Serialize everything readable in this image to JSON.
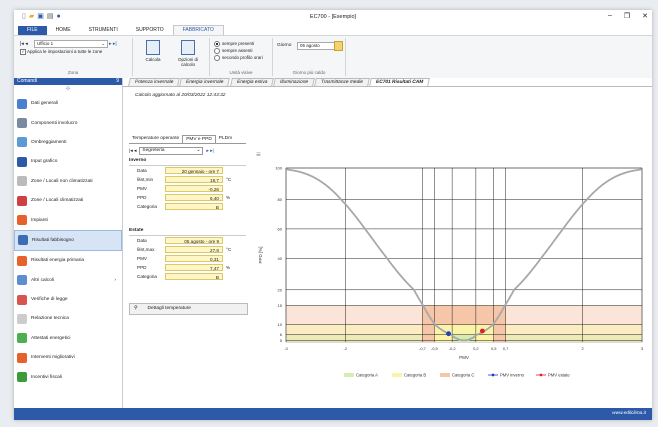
{
  "window": {
    "title": "EC700 - [Esempio]",
    "min": "–",
    "max": "❐",
    "close": "✕"
  },
  "ribbon_tabs": [
    "FILE",
    "HOME",
    "STRUMENTI",
    "SUPPORTO",
    "FABBRICATO"
  ],
  "ribbon": {
    "zona": {
      "select": "Ufficio 1",
      "checkbox_label": "Applica le impostazioni a tutte le zone",
      "caption": "Zona"
    },
    "calcolo_label": "Calcola",
    "opzioni_label": "Opzioni di calcolo",
    "radio_options": [
      "sempre presenti",
      "sempre assenti",
      "secondo profilo orari"
    ],
    "unita_caption": "Unità visive",
    "giorno_label": "Giorno",
    "giorno_value": "05 agosto",
    "giorno_caption": "Giorno più caldo"
  },
  "sidebar": {
    "header": "Comandi",
    "header_count": "9",
    "items": [
      {
        "label": "Dati generali",
        "icon": "folder-icon",
        "color": "#4a7fcf"
      },
      {
        "label": "Componenti involucro",
        "icon": "wall-icon",
        "color": "#7a8aa0"
      },
      {
        "label": "Ombreggiamenti",
        "icon": "shading-icon",
        "color": "#5b9bd5"
      },
      {
        "label": "Input grafico",
        "icon": "graphic-input-icon",
        "color": "#2c5aa8"
      },
      {
        "label": "Zone / Locali non climatizzati",
        "icon": "zone-icon",
        "color": "#bbbbbb"
      },
      {
        "label": "Zone / Locali climatizzati",
        "icon": "zone-climatized-icon",
        "color": "#d04040"
      },
      {
        "label": "Impianti",
        "icon": "flame-icon",
        "color": "#e8602c"
      },
      {
        "label": "Risultati fabbisogno",
        "icon": "results-grid-icon",
        "color": "#3b6cb5"
      },
      {
        "label": "Risultati energia primaria",
        "icon": "primary-energy-icon",
        "color": "#e8602c"
      },
      {
        "label": "Altri calcoli",
        "icon": "other-calc-icon",
        "color": "#5b8fd0",
        "arrow": "›"
      },
      {
        "label": "Verifiche di legge",
        "icon": "check-icon",
        "color": "#d9534f"
      },
      {
        "label": "Relazione tecnica",
        "icon": "report-icon",
        "color": "#cccccc"
      },
      {
        "label": "Attestati energetici",
        "icon": "certificate-icon",
        "color": "#4caf50"
      },
      {
        "label": "Interventi migliorativi",
        "icon": "house-icon",
        "color": "#e8602c"
      },
      {
        "label": "Incentivi fiscali",
        "icon": "leaf-icon",
        "color": "#3b9b3b"
      }
    ],
    "active_index": 7
  },
  "tabs": [
    "Potenza invernale",
    "Energia invernale",
    "Energia estiva",
    "Illuminazione",
    "Trasmittanze medie",
    "EC701 Risultati CAM"
  ],
  "active_tab": 5,
  "stamp": "Calcolo aggiornato al 20/03/2022 12:43:32",
  "subtabs": [
    "Temperature operante",
    "PMV e PPD",
    "PLDm"
  ],
  "active_subtab": 1,
  "nav": {
    "select": "Segreteria"
  },
  "inverno": {
    "title": "Inverno",
    "rows": [
      {
        "label": "Data",
        "value": "20 gennaio - ore 7",
        "unit": ""
      },
      {
        "label": "θint,min",
        "value": "18,7",
        "unit": "°C"
      },
      {
        "label": "PMV",
        "value": "-0,26",
        "unit": ""
      },
      {
        "label": "PPD",
        "value": "6,40",
        "unit": "%"
      },
      {
        "label": "Categoria",
        "value": "B",
        "unit": ""
      }
    ]
  },
  "estate": {
    "title": "Estate",
    "rows": [
      {
        "label": "Data",
        "value": "05 agosto - ore 9",
        "unit": ""
      },
      {
        "label": "θint,max",
        "value": "27,8",
        "unit": "°C"
      },
      {
        "label": "PMV",
        "value": "0,31",
        "unit": ""
      },
      {
        "label": "PPD",
        "value": "7,47",
        "unit": "%"
      },
      {
        "label": "Categoria",
        "value": "B",
        "unit": ""
      }
    ]
  },
  "details_button": "Dettagli temperature",
  "statusbar": "www.edilclima.it",
  "chart_data": {
    "type": "line",
    "xlabel": "PMV",
    "ylabel": "PPD [%]",
    "xlim": [
      -3,
      3
    ],
    "ylim": [
      0,
      100
    ],
    "x_ticks": [
      -3,
      -2,
      -0.7,
      -0.5,
      -0.2,
      0.2,
      0.5,
      0.7,
      2,
      3
    ],
    "x_tick_labels": [
      "-3",
      "-2",
      "-0,7",
      "-0,5",
      "-0,2",
      "0,2",
      "0,5",
      "0,7",
      "2",
      "3"
    ],
    "y_ticks": [
      5,
      6,
      10,
      15,
      20,
      40,
      60,
      80,
      100
    ],
    "y_tick_labels": [
      "5",
      "6",
      "10",
      "15",
      "20",
      "40",
      "60",
      "80",
      "100"
    ],
    "curve": "PPD = 100 - 95*exp(-0.03353*PMV^4 - 0.2179*PMV^2)",
    "bands": [
      {
        "name": "Categoria A",
        "pmv": [
          -0.2,
          0.2
        ],
        "ppd_max": 6,
        "color": "#d6ecb0"
      },
      {
        "name": "Categoria B",
        "pmv": [
          -0.5,
          0.5
        ],
        "ppd_max": 10,
        "color": "#fbf3a8"
      },
      {
        "name": "Categoria C",
        "pmv": [
          -0.7,
          0.7
        ],
        "ppd_max": 15,
        "color": "#f6c6a8"
      }
    ],
    "points": [
      {
        "name": "PMV inverno",
        "pmv": -0.26,
        "ppd": 6.4,
        "color": "#1f3fbf"
      },
      {
        "name": "PMV estate",
        "pmv": 0.31,
        "ppd": 7.47,
        "color": "#e02020"
      }
    ],
    "legend": [
      "Categoria A",
      "Categoria B",
      "Categoria C",
      "PMV inverno",
      "PMV estate"
    ],
    "legend_position": "bottom",
    "grid": true
  }
}
